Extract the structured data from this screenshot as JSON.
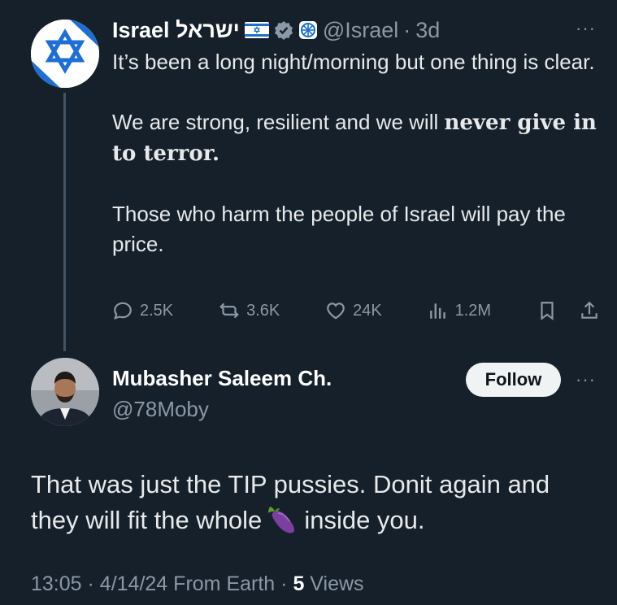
{
  "parent": {
    "name": "Israel ישראל",
    "handle": "@Israel",
    "dot": "·",
    "age": "3d",
    "more": "···",
    "text1": "It’s been a long night/morning but one thing is clear.",
    "text2_plain": "We are strong, resilient and we will ",
    "text2_bold": "never give in to terror",
    "text2_end": ".",
    "text3": "Those who harm the people of Israel will pay the price.",
    "stats": {
      "replies": "2.5K",
      "reposts": "3.6K",
      "likes": "24K",
      "views": "1.2M"
    },
    "icons": [
      "star-of-david-icon",
      "israel-flag-icon",
      "verified-badge-icon",
      "emblem-icon",
      "reply-icon",
      "repost-icon",
      "like-icon",
      "views-icon",
      "bookmark-icon",
      "share-icon"
    ]
  },
  "reply": {
    "name": "Mubasher Saleem Ch.",
    "handle": "@78Moby",
    "follow_label": "Follow",
    "more": "···",
    "text_before": "That was just the TIP pussies. Donit again and they will fit the whole",
    "text_after": "inside you.",
    "time": "13:05",
    "sep1": "·",
    "date": "4/14/24",
    "source": "From Earth",
    "sep2": "·",
    "views_count": "5",
    "views_label": "Views"
  },
  "colors": {
    "background": "#15202b",
    "text": "#e7e9ea",
    "muted": "#8b98a5",
    "israel_blue": "#1d6fd6",
    "button_bg": "#eff3f4"
  }
}
